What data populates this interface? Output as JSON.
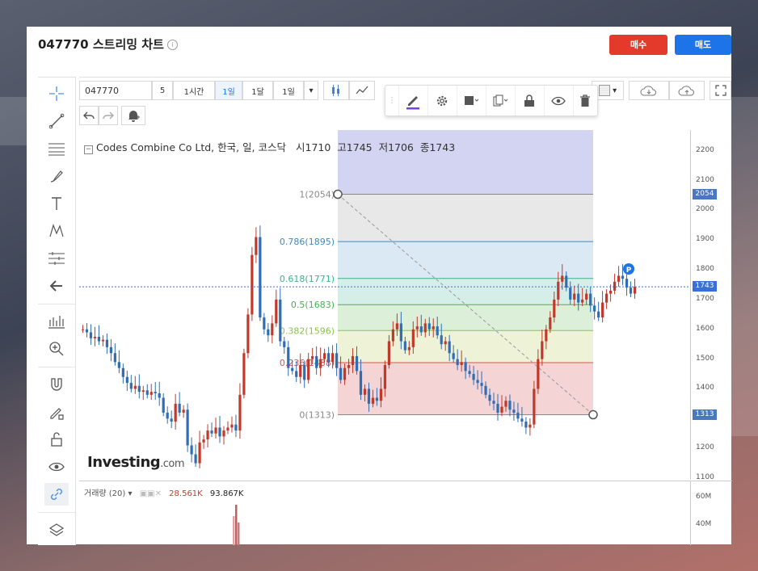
{
  "page": {
    "title": "047770 스트리밍 차트",
    "info_icon": "i",
    "buy_label": "매수",
    "sell_label": "매도",
    "colors": {
      "buy": "#e33a2b",
      "sell": "#1d73e8",
      "up": "#c0392b",
      "down": "#2f6db5"
    }
  },
  "toolbar": {
    "symbol": "047770",
    "compare": "5",
    "interval_1h": "1시간",
    "interval_1d": "1일",
    "interval_1m": "1달",
    "interval_sel": "1일",
    "dropdown": "▾"
  },
  "float_toolbar": {
    "icons": [
      "pencil-icon",
      "gear-icon",
      "fill-icon",
      "copy-icon",
      "lock-icon",
      "eye-icon",
      "trash-icon"
    ]
  },
  "left_tools": {
    "icons": [
      "crosshair-icon",
      "trendline-icon",
      "fib-icon",
      "brush-icon",
      "text-icon",
      "pattern-icon",
      "measure-icon",
      "back-arrow-icon",
      "ruler-icon",
      "zoom-icon",
      "magnet-icon",
      "lock-draw-icon",
      "unlock-icon",
      "eye-icon",
      "link-icon",
      "layers-icon"
    ]
  },
  "legend": {
    "name": "Codes Combine Co Ltd, 한국, 일, 코스닥",
    "open_label": "시",
    "open": "1710",
    "high_label": "고",
    "high": "1745",
    "low_label": "저",
    "low": "1706",
    "close_label": "종",
    "close": "1743"
  },
  "fib_labels": [
    {
      "text": "1(2054)"
    },
    {
      "text": "0.786(1895)"
    },
    {
      "text": "0.618(1771)"
    },
    {
      "text": "0.5(1683)"
    },
    {
      "text": "0.382(1596)"
    },
    {
      "text": "0.236(1488)"
    },
    {
      "text": "0(1313)"
    }
  ],
  "y_ticks": [
    "2200",
    "2100",
    "2000",
    "1900",
    "1800",
    "1700",
    "1600",
    "1500",
    "1400",
    "1300",
    "1200",
    "1100"
  ],
  "y_tags": {
    "top": "2054",
    "last": "1743",
    "bottom": "1313"
  },
  "watermark": {
    "brand": "Investing",
    "domain": ".com"
  },
  "volume": {
    "label": "거래량 (20)",
    "value1": "28.561K",
    "value2": "93.867K",
    "ticks": [
      "60M",
      "40M"
    ]
  },
  "chart_data": {
    "type": "candlestick",
    "ylim": [
      1100,
      2240
    ],
    "fib_levels": [
      2054,
      1895,
      1771,
      1683,
      1596,
      1488,
      1313
    ],
    "closes": [
      1600,
      1590,
      1570,
      1575,
      1560,
      1565,
      1540,
      1520,
      1490,
      1470,
      1440,
      1420,
      1400,
      1410,
      1390,
      1395,
      1380,
      1390,
      1385,
      1370,
      1320,
      1300,
      1290,
      1350,
      1320,
      1330,
      1210,
      1180,
      1150,
      1220,
      1230,
      1260,
      1250,
      1270,
      1240,
      1260,
      1270,
      1280,
      1260,
      1380,
      1520,
      1650,
      1850,
      1910,
      1640,
      1600,
      1580,
      1620,
      1700,
      1560,
      1540,
      1470,
      1460,
      1440,
      1480,
      1430,
      1500,
      1510,
      1470,
      1500,
      1520,
      1490,
      1520,
      1470,
      1430,
      1470,
      1480,
      1510,
      1460,
      1380,
      1400,
      1350,
      1370,
      1360,
      1400,
      1480,
      1560,
      1600,
      1620,
      1560,
      1530,
      1540,
      1600,
      1610,
      1590,
      1620,
      1600,
      1610,
      1580,
      1550,
      1560,
      1520,
      1500,
      1480,
      1490,
      1460,
      1450,
      1430,
      1420,
      1410,
      1380,
      1360,
      1350,
      1320,
      1340,
      1360,
      1330,
      1320,
      1300,
      1290,
      1270,
      1280,
      1400,
      1500,
      1560,
      1600,
      1640,
      1700,
      1760,
      1780,
      1740,
      1700,
      1720,
      1690,
      1700,
      1720,
      1680,
      1660,
      1640,
      1690,
      1720,
      1730,
      1760,
      1780,
      1770,
      1740,
      1720,
      1743
    ]
  }
}
